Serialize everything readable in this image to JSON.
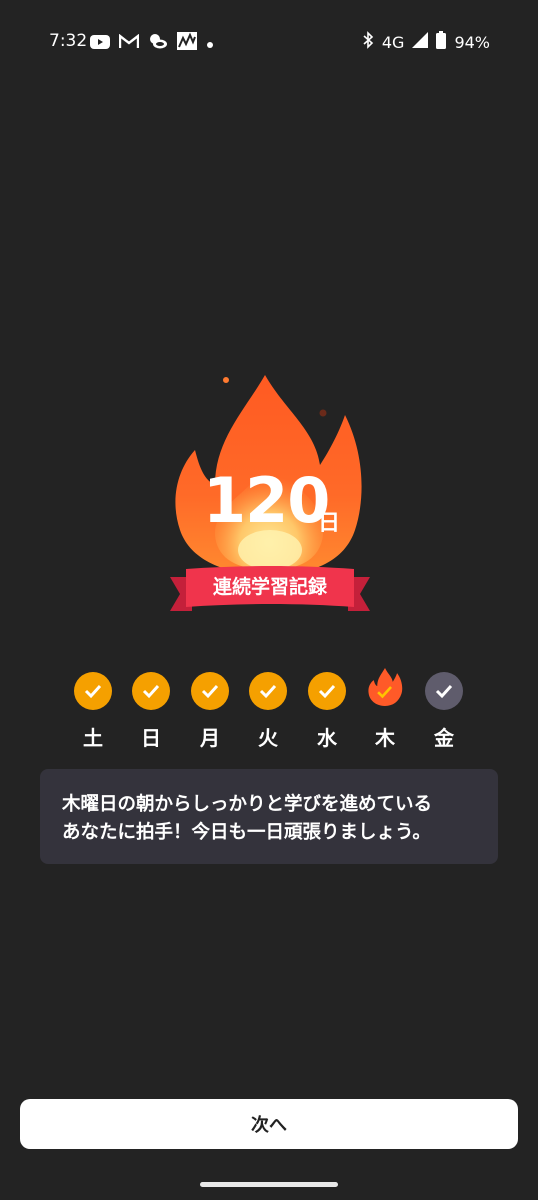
{
  "status_bar": {
    "time": "7:32",
    "network": "4G",
    "battery": "94%",
    "left_icons": [
      "youtube-icon",
      "gmail-icon",
      "weather-icon",
      "stocks-icon",
      "dot-icon"
    ],
    "right_icons": [
      "bluetooth-icon",
      "signal-icon",
      "battery-icon"
    ]
  },
  "streak": {
    "count": "120",
    "unit": "日",
    "ribbon_label": "連続学習記録"
  },
  "week": {
    "days": [
      {
        "label": "土",
        "state": "done"
      },
      {
        "label": "日",
        "state": "done"
      },
      {
        "label": "月",
        "state": "done"
      },
      {
        "label": "火",
        "state": "done"
      },
      {
        "label": "水",
        "state": "done"
      },
      {
        "label": "木",
        "state": "today"
      },
      {
        "label": "金",
        "state": "pending"
      }
    ]
  },
  "message": {
    "line1": "木曜日の朝からしっかりと学びを進めている",
    "line2": "あなたに拍手！今日も一日頑張りましょう。"
  },
  "footer": {
    "next_label": "次へ"
  },
  "colors": {
    "background": "#232323",
    "done": "#f5a000",
    "today": "#ff5a28",
    "pending": "#5f5c6c",
    "ribbon": "#f0344c",
    "card": "#34333c"
  }
}
